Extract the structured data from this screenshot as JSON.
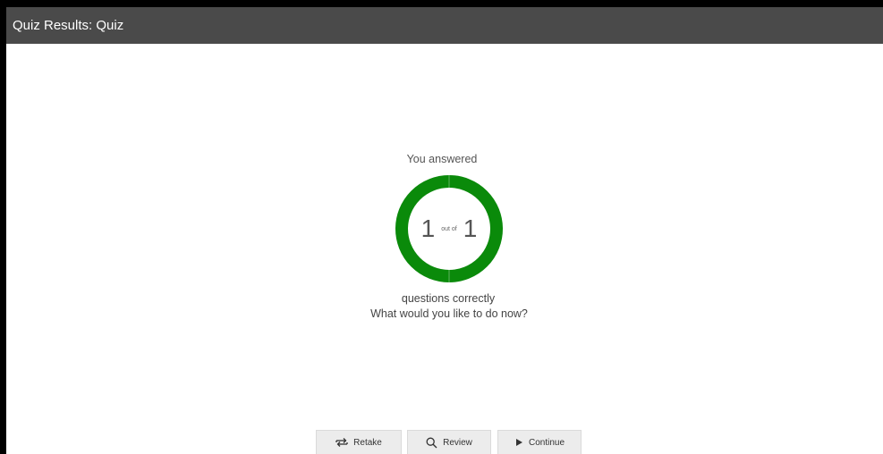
{
  "header": {
    "title": "Quiz Results: Quiz"
  },
  "result": {
    "intro": "You answered",
    "correct": "1",
    "out_of_label": "out of",
    "total": "1",
    "suffix": "questions correctly",
    "prompt": "What would you like to do now?",
    "score_fraction": 1.0,
    "ring_color": "#0a8a0a"
  },
  "actions": {
    "retake_label": "Retake",
    "review_label": "Review",
    "continue_label": "Continue",
    "retake_icon": "retake-icon",
    "review_icon": "search-icon",
    "continue_icon": "play-icon"
  }
}
